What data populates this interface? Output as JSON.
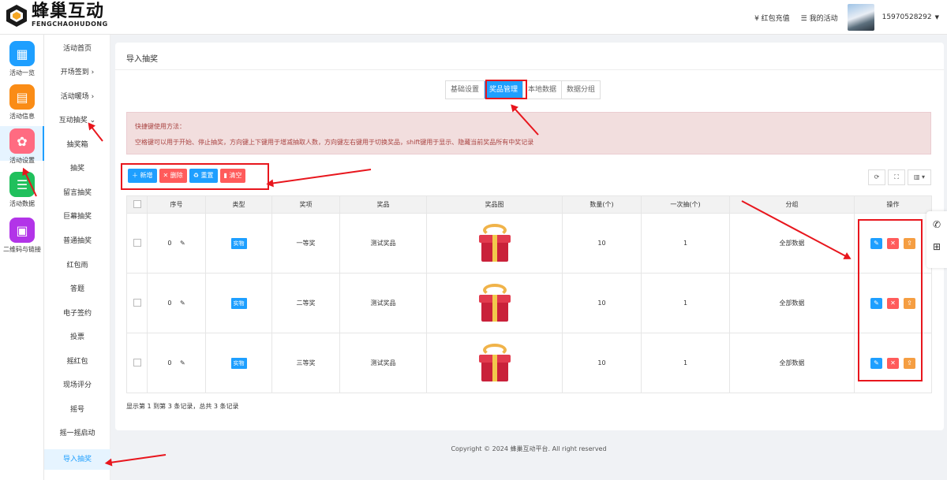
{
  "brand": {
    "name_cn": "蜂巢互动",
    "name_en": "FENGCHAOHUDONG"
  },
  "topnav": {
    "recharge": "¥ 红包充值",
    "activities": "☰ 我的活动",
    "user": "15970528292",
    "caret": "▼"
  },
  "iconbar": [
    {
      "label": "活动一览",
      "icon": "grid-icon",
      "color": "#1e9fff",
      "glyph": "▦"
    },
    {
      "label": "活动信息",
      "icon": "document-icon",
      "color": "#fa8c16",
      "glyph": "▤"
    },
    {
      "label": "活动设置",
      "icon": "gear-icon",
      "color": "#ff6b81",
      "glyph": "✿"
    },
    {
      "label": "活动数据",
      "icon": "database-icon",
      "color": "#20c05c",
      "glyph": "☰"
    },
    {
      "label": "二维码与链接",
      "icon": "qrcode-icon",
      "color": "#b234e8",
      "glyph": "▣"
    }
  ],
  "menu": [
    {
      "label": "活动首页"
    },
    {
      "label": "开场签到 ›"
    },
    {
      "label": "活动暖场 ›"
    },
    {
      "label": "互动抽奖 ⌄"
    },
    {
      "label": "抽奖箱"
    },
    {
      "label": "抽奖"
    },
    {
      "label": "留言抽奖"
    },
    {
      "label": "巨幕抽奖"
    },
    {
      "label": "普通抽奖"
    },
    {
      "label": "红包雨"
    },
    {
      "label": "答题"
    },
    {
      "label": "电子签约"
    },
    {
      "label": "投票"
    },
    {
      "label": "摇红包"
    },
    {
      "label": "现场评分"
    },
    {
      "label": "摇号"
    },
    {
      "label": "摇一摇启动"
    },
    {
      "label": "导入抽奖"
    }
  ],
  "page": {
    "title": "导入抽奖"
  },
  "tabs": [
    "基础设置",
    "奖品管理",
    "本地数据",
    "数据分组"
  ],
  "notice": {
    "line1": "快捷键使用方法：",
    "line2": "空格键可以用于开始、停止抽奖，方向键上下键用于增减抽取人数，方向键左右键用于切换奖品，shift键用于显示、隐藏当前奖品所有中奖记录"
  },
  "toolbar": {
    "add": "＋ 新增",
    "delete": "✕ 删除",
    "reset": "♻ 重置",
    "clear": "▮ 清空"
  },
  "tools": [
    "⟳",
    "⛶",
    "▥ ▾"
  ],
  "table": {
    "headers": [
      "序号",
      "类型",
      "奖项",
      "奖品",
      "奖品图",
      "数量(个)",
      "一次抽(个)",
      "分组",
      "操作"
    ],
    "rows": [
      {
        "seq": "0",
        "type": "实物",
        "level": "一等奖",
        "prize": "测试奖品",
        "qty": "10",
        "per": "1",
        "group": "全部数据"
      },
      {
        "seq": "0",
        "type": "实物",
        "level": "二等奖",
        "prize": "测试奖品",
        "qty": "10",
        "per": "1",
        "group": "全部数据"
      },
      {
        "seq": "0",
        "type": "实物",
        "level": "三等奖",
        "prize": "测试奖品",
        "qty": "10",
        "per": "1",
        "group": "全部数据"
      }
    ]
  },
  "footer": {
    "summary": "显示第 1 到第 3 条记录，总共 3 条记录",
    "copyright": "Copyright © 2024 蜂巢互动平台. All right reserved"
  },
  "colors": {
    "accent": "#1e9fff",
    "danger": "#ff5b5b",
    "warning": "#f59e42",
    "annotation": "#e8161d"
  }
}
